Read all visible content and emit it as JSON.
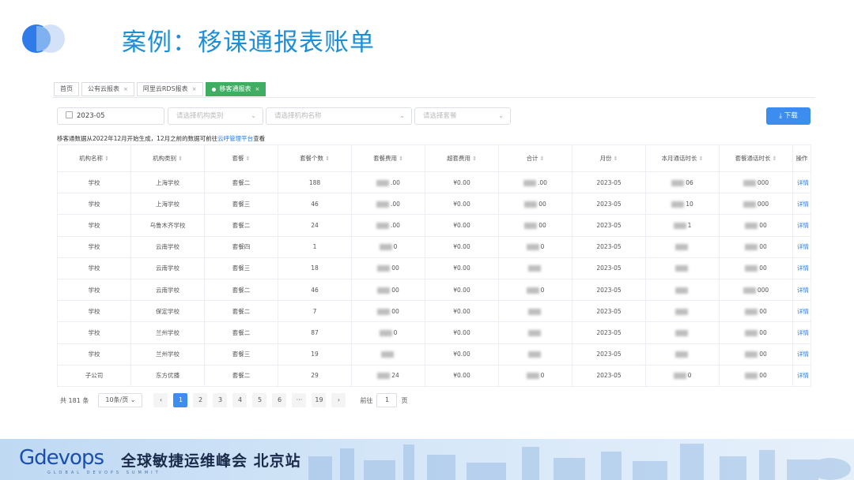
{
  "slide": {
    "title": "案例：移课通报表账单"
  },
  "tabs": [
    {
      "label": "首页",
      "closable": false,
      "active": false
    },
    {
      "label": "公有云报表",
      "closable": true,
      "active": false
    },
    {
      "label": "阿里云RDS报表",
      "closable": true,
      "active": false
    },
    {
      "label": "移客通报表",
      "closable": true,
      "active": true
    }
  ],
  "filters": {
    "date_value": "2023-05",
    "org_type_placeholder": "请选择机构类别",
    "org_name_placeholder": "请选择机构名称",
    "package_placeholder": "请选择套餐",
    "download_label": "下载"
  },
  "note": {
    "text": "移客通数据从2022年12月开始生成，12月之前的数据可前往",
    "link": "云呼管理平台",
    "suffix": "查看"
  },
  "table": {
    "headers": [
      "机构名称",
      "机构类别",
      "套餐",
      "套餐个数",
      "套餐费用",
      "超套费用",
      "合计",
      "月份",
      "本月通话时长",
      "套餐通话时长",
      "操作"
    ],
    "rows": [
      [
        "学校",
        "上海学校",
        "套餐二",
        "188",
        ".00",
        "¥0.00",
        ".00",
        "2023-05",
        "06",
        "000",
        "详情"
      ],
      [
        "学校",
        "上海学校",
        "套餐三",
        "46",
        ".00",
        "¥0.00",
        "00",
        "2023-05",
        "10",
        "000",
        "详情"
      ],
      [
        "学校",
        "乌鲁木齐学校",
        "套餐二",
        "24",
        ".00",
        "¥0.00",
        "00",
        "2023-05",
        "1",
        "00",
        "详情"
      ],
      [
        "学校",
        "云南学校",
        "套餐四",
        "1",
        "0",
        "¥0.00",
        "0",
        "2023-05",
        "",
        "00",
        "详情"
      ],
      [
        "学校",
        "云南学校",
        "套餐三",
        "18",
        "00",
        "¥0.00",
        "",
        "2023-05",
        "",
        "00",
        "详情"
      ],
      [
        "学校",
        "云南学校",
        "套餐二",
        "46",
        "00",
        "¥0.00",
        "0",
        "2023-05",
        "",
        "000",
        "详情"
      ],
      [
        "学校",
        "保定学校",
        "套餐二",
        "7",
        "00",
        "¥0.00",
        "",
        "2023-05",
        "",
        "00",
        "详情"
      ],
      [
        "学校",
        "兰州学校",
        "套餐二",
        "87",
        "0",
        "¥0.00",
        "",
        "2023-05",
        "",
        "00",
        "详情"
      ],
      [
        "学校",
        "兰州学校",
        "套餐三",
        "19",
        "",
        "¥0.00",
        "",
        "2023-05",
        "",
        "00",
        "详情"
      ],
      [
        "子公司",
        "东方优播",
        "套餐二",
        "29",
        "24",
        "¥0.00",
        "0",
        "2023-05",
        "0",
        "00",
        "详情"
      ]
    ]
  },
  "pagination": {
    "total": "共 181 条",
    "page_size": "10条/页",
    "prev": "‹",
    "pages": [
      "1",
      "2",
      "3",
      "4",
      "5",
      "6",
      "···",
      "19"
    ],
    "next": "›",
    "goto_label": "前往",
    "goto_value": "1",
    "goto_suffix": "页"
  },
  "footer": {
    "brand": "Gdevops",
    "title": "全球敏捷运维峰会 北京站",
    "subtitle": "GLOBAL DEVOPS SUMMIT"
  }
}
